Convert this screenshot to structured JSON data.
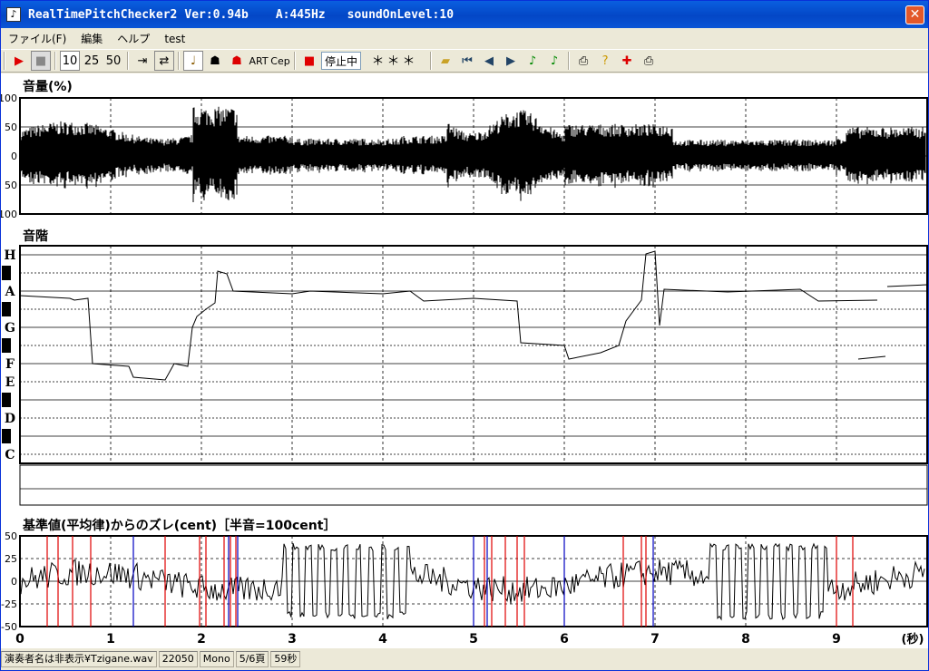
{
  "window": {
    "title_app": "RealTimePitchChecker2",
    "title_ver": "Ver:0.94b",
    "title_a": "A:445Hz",
    "title_level": "soundOnLevel:10"
  },
  "menu": [
    "ファイル(F)",
    "編集",
    "ヘルプ",
    "test"
  ],
  "toolbar": {
    "speed": [
      "10",
      "25",
      "50"
    ],
    "art": "ART",
    "cep": "Cep",
    "status": "停止中",
    "note": "＊＊＊"
  },
  "panels": {
    "volume": "音量(%)",
    "scale": "音階",
    "deviation": "基準値(平均律)からのズレ(cent)［半音=100cent］"
  },
  "volume_ticks": [
    "100",
    "50",
    "0",
    "50",
    "100"
  ],
  "scale_notes": [
    "H",
    "A",
    "G",
    "F",
    "E",
    "D",
    "C"
  ],
  "dev_ticks": [
    "50",
    "25",
    "0",
    "-25",
    "-50"
  ],
  "time_ticks": [
    "0",
    "1",
    "2",
    "3",
    "4",
    "5",
    "6",
    "7",
    "8",
    "9"
  ],
  "time_unit": "(秒)",
  "statusbar": [
    "演奏者名は非表示¥Tzigane.wav",
    "22050",
    "Mono",
    "5/6頁",
    "59秒"
  ],
  "colors": {
    "title": "#0a5fe0",
    "red": "#e00000",
    "blue": "#0000c0"
  }
}
